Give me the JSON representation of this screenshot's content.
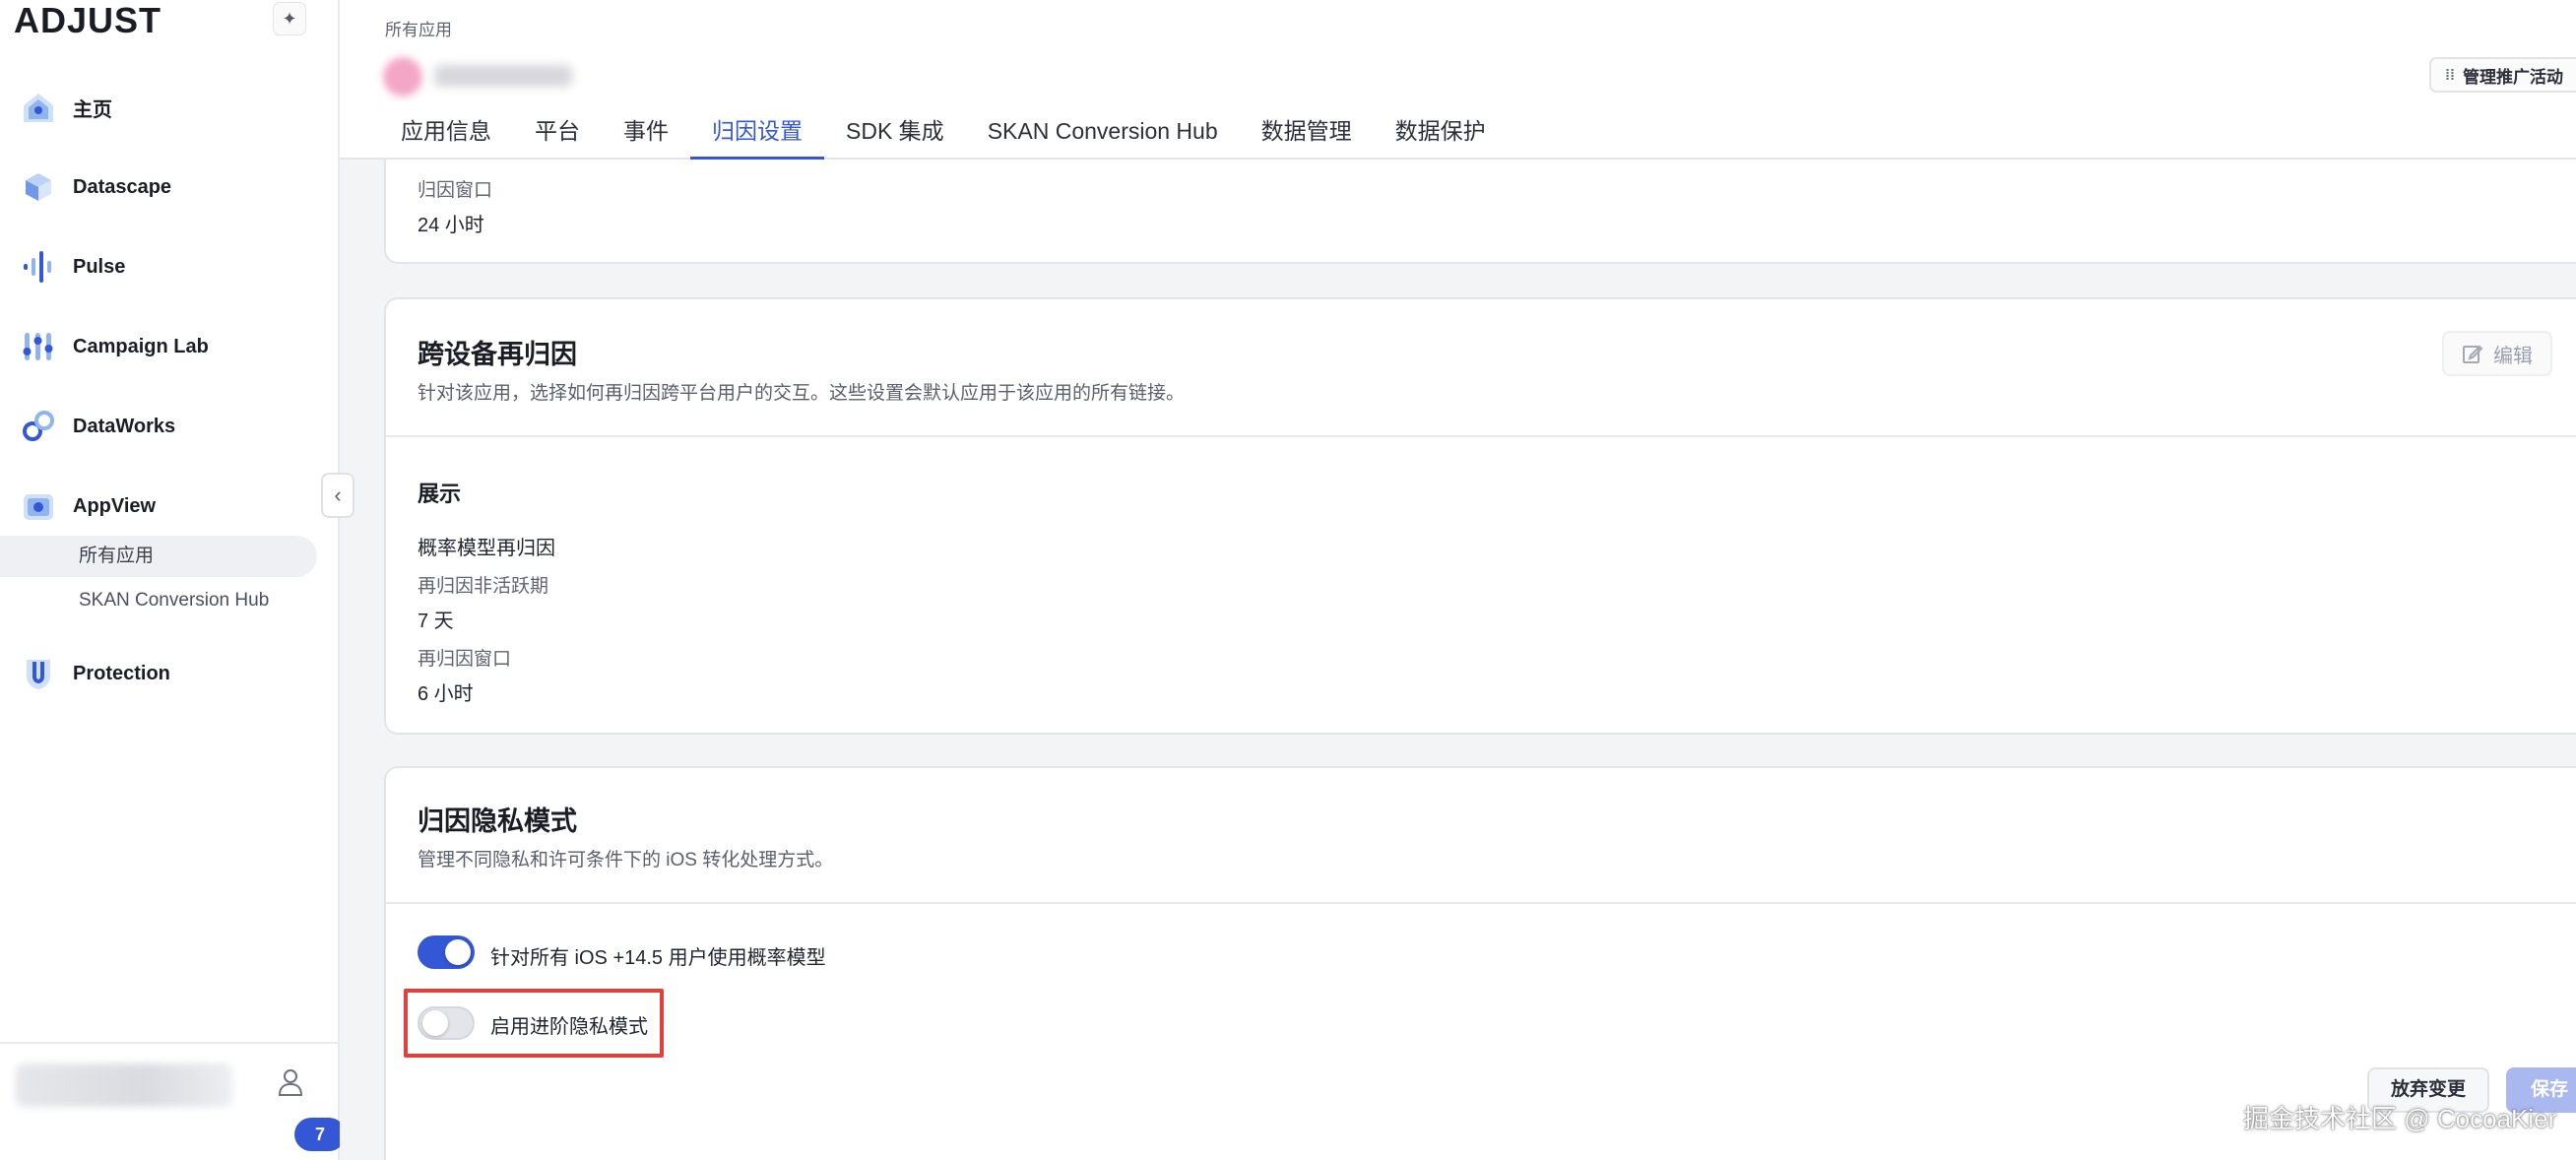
{
  "sidebar": {
    "logo": "ADJUST",
    "pin_icon": "pin-icon",
    "items": [
      {
        "label": "主页",
        "icon": "home-icon"
      },
      {
        "label": "Datascape",
        "icon": "datascape-icon"
      },
      {
        "label": "Pulse",
        "icon": "pulse-icon"
      },
      {
        "label": "Campaign Lab",
        "icon": "campaign-lab-icon"
      },
      {
        "label": "DataWorks",
        "icon": "dataworks-icon"
      },
      {
        "label": "AppView",
        "icon": "appview-icon"
      },
      {
        "label": "Protection",
        "icon": "protection-icon"
      }
    ],
    "subitems": [
      {
        "label": "所有应用",
        "active": true
      },
      {
        "label": "SKAN Conversion Hub",
        "active": false
      }
    ],
    "collapse_glyph": "‹",
    "badge_count": "7"
  },
  "header": {
    "breadcrumb": "所有应用",
    "manage_button": "管理推广活动",
    "tabs": [
      {
        "label": "应用信息",
        "active": false
      },
      {
        "label": "平台",
        "active": false
      },
      {
        "label": "事件",
        "active": false
      },
      {
        "label": "归因设置",
        "active": true
      },
      {
        "label": "SDK 集成",
        "active": false
      },
      {
        "label": "SKAN Conversion Hub",
        "active": false
      },
      {
        "label": "数据管理",
        "active": false
      },
      {
        "label": "数据保护",
        "active": false
      }
    ]
  },
  "card1": {
    "label": "归因窗口",
    "value": "24 小时"
  },
  "card2": {
    "title": "跨设备再归因",
    "description": "针对该应用，选择如何再归因跨平台用户的交互。这些设置会默认应用于该应用的所有链接。",
    "edit_button": "编辑",
    "section_title": "展示",
    "model_label": "概率模型再归因",
    "inactivity_label": "再归因非活跃期",
    "inactivity_value": "7 天",
    "window_label": "再归因窗口",
    "window_value": "6 小时"
  },
  "card3": {
    "title": "归因隐私模式",
    "description": "管理不同隐私和许可条件下的 iOS 转化处理方式。",
    "toggle1_label": "针对所有 iOS +14.5 用户使用概率模型",
    "toggle1_on": true,
    "toggle2_label": "启用进阶隐私模式",
    "toggle2_on": false,
    "discard_button": "放弃变更",
    "save_button": "保存"
  },
  "watermark": "掘金技术社区 @ CocoaKier",
  "colors": {
    "accent": "#3457d5",
    "highlight": "#e0413a",
    "save_disabled": "#a9b8ef"
  }
}
